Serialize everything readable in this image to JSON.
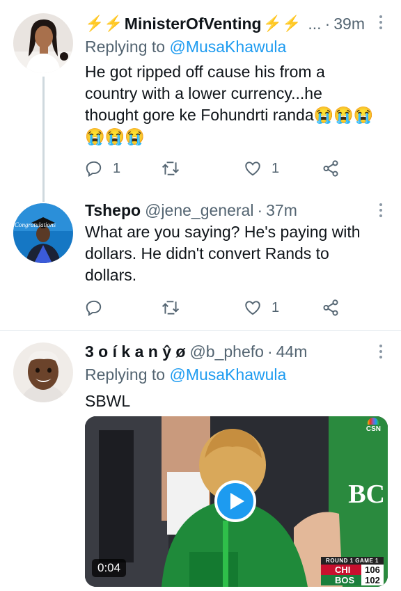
{
  "tweets": [
    {
      "display_name": "MinisterOfVenting",
      "name_emoji": "⚡⚡",
      "handle_truncated": "...",
      "time": "39m",
      "replying_to_label": "Replying to",
      "replying_to_mention": "@MusaKhawula",
      "text": "He got ripped off cause his from a\ncountry with a lower currency...he\nthought gore ke Fohundrti randa😭😭😭\n😭😭😭",
      "reply_count": "1",
      "retweet_count": "",
      "like_count": "1"
    },
    {
      "display_name": "Tshepo",
      "handle": "@jene_general",
      "time": "37m",
      "text": "What are you saying? He's paying with\ndollars. He didn't convert Rands to\ndollars.",
      "reply_count": "",
      "retweet_count": "",
      "like_count": "1",
      "avatar_caption": "Congratulations"
    },
    {
      "display_name": "3 o í k a n ŷ ø",
      "handle": "@b_phefo",
      "time": "44m",
      "replying_to_label": "Replying to",
      "replying_to_mention": "@MusaKhawula",
      "text": "SBWL",
      "media": {
        "duration": "0:04",
        "network": "CSN",
        "jersey_text": "BC",
        "scorebug": {
          "header": "ROUND 1 GAME 1",
          "team1": "CHI",
          "score1": "106",
          "team2": "BOS",
          "score2": "102"
        }
      }
    }
  ],
  "icons": [
    "reply-icon",
    "retweet-icon",
    "like-icon",
    "share-icon",
    "more-icon",
    "play-icon"
  ],
  "colors": {
    "accent": "#1d9bf0",
    "secondary_text": "#536471",
    "bolt": "#f5b800"
  }
}
